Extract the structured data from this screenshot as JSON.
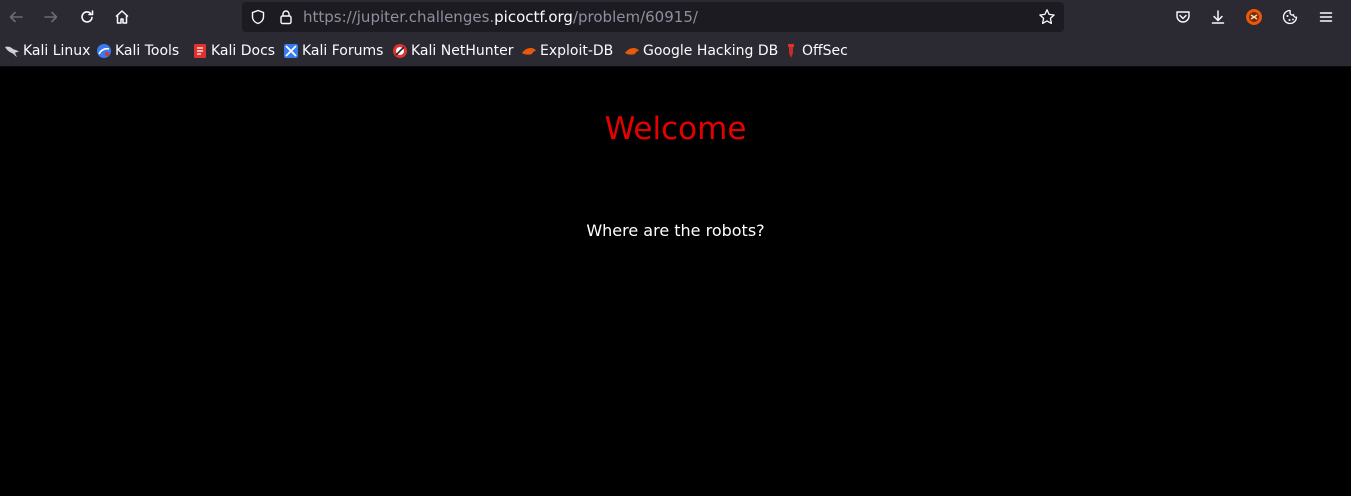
{
  "browser": {
    "url_prefix": "https://jupiter.challenges.",
    "url_domain": "picoctf.org",
    "url_path": "/problem/60915/",
    "toolbar_icons": [
      "back-icon",
      "forward-icon",
      "reload-icon",
      "home-icon",
      "shield-icon",
      "lock-icon",
      "star-icon",
      "pocket-icon",
      "download-icon",
      "extension-icon",
      "cookie-icon",
      "menu-icon"
    ]
  },
  "bookmarks": [
    {
      "label": "Kali Linux",
      "icon": "kali-dragon-icon"
    },
    {
      "label": "Kali Tools",
      "icon": "kali-tools-icon"
    },
    {
      "label": "Kali Docs",
      "icon": "kali-docs-icon"
    },
    {
      "label": "Kali Forums",
      "icon": "kali-forums-icon"
    },
    {
      "label": "Kali NetHunter",
      "icon": "nethunter-icon"
    },
    {
      "label": "Exploit-DB",
      "icon": "exploit-db-icon"
    },
    {
      "label": "Google Hacking DB",
      "icon": "ghdb-icon"
    },
    {
      "label": "OffSec",
      "icon": "offsec-icon"
    }
  ],
  "page": {
    "heading": "Welcome",
    "message": "Where are the robots?",
    "heading_color": "#e60000",
    "background": "#000000"
  }
}
